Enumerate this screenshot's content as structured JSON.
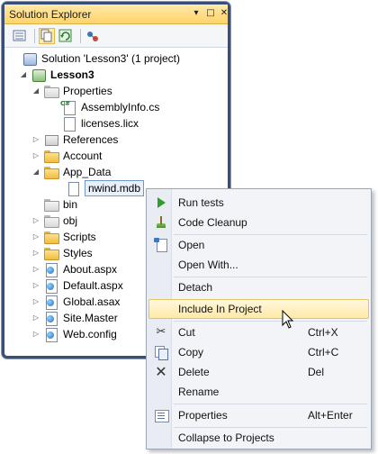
{
  "window": {
    "title": "Solution Explorer",
    "title_buttons": [
      "▾",
      "□",
      "✕"
    ]
  },
  "toolbar": {
    "icons": [
      "properties-icon",
      "show-all-files-icon",
      "refresh-icon",
      "view-class-diagram-icon"
    ]
  },
  "tree": {
    "items": [
      {
        "label": "Solution 'Lesson3' (1 project)",
        "icon": "solution-icon",
        "arrow": ""
      },
      {
        "label": "Lesson3",
        "icon": "web-project-icon",
        "arrow": "◢"
      },
      {
        "label": "Properties",
        "icon": "properties-folder-icon",
        "arrow": "◢"
      },
      {
        "label": "AssemblyInfo.cs",
        "icon": "csharp-file-icon",
        "arrow": ""
      },
      {
        "label": "licenses.licx",
        "icon": "file-icon",
        "arrow": ""
      },
      {
        "label": "References",
        "icon": "references-icon",
        "arrow": "▷"
      },
      {
        "label": "Account",
        "icon": "folder-icon",
        "arrow": "▷"
      },
      {
        "label": "App_Data",
        "icon": "folder-icon",
        "arrow": "◢"
      },
      {
        "label": "nwind.mdb",
        "icon": "database-file-icon",
        "arrow": ""
      },
      {
        "label": "bin",
        "icon": "hidden-folder-icon",
        "arrow": ""
      },
      {
        "label": "obj",
        "icon": "hidden-folder-icon",
        "arrow": "▷"
      },
      {
        "label": "Scripts",
        "icon": "folder-icon",
        "arrow": "▷"
      },
      {
        "label": "Styles",
        "icon": "folder-icon",
        "arrow": "▷"
      },
      {
        "label": "About.aspx",
        "icon": "aspx-file-icon",
        "arrow": "▷"
      },
      {
        "label": "Default.aspx",
        "icon": "aspx-file-icon",
        "arrow": "▷"
      },
      {
        "label": "Global.asax",
        "icon": "asax-file-icon",
        "arrow": "▷"
      },
      {
        "label": "Site.Master",
        "icon": "master-file-icon",
        "arrow": "▷"
      },
      {
        "label": "Web.config",
        "icon": "config-file-icon",
        "arrow": "▷"
      }
    ],
    "selected_item": "nwind.mdb"
  },
  "context_menu": {
    "items": [
      {
        "label": "Run tests",
        "shortcut": "",
        "icon": "run-tests-icon"
      },
      {
        "label": "Code Cleanup",
        "shortcut": "",
        "icon": "code-cleanup-icon"
      },
      {
        "label": "Open",
        "shortcut": "",
        "icon": "open-icon"
      },
      {
        "label": "Open With...",
        "shortcut": "",
        "icon": ""
      },
      {
        "label": "Detach",
        "shortcut": "",
        "icon": ""
      },
      {
        "label": "Include In Project",
        "shortcut": "",
        "icon": ""
      },
      {
        "label": "Cut",
        "shortcut": "Ctrl+X",
        "icon": "cut-icon"
      },
      {
        "label": "Copy",
        "shortcut": "Ctrl+C",
        "icon": "copy-icon"
      },
      {
        "label": "Delete",
        "shortcut": "Del",
        "icon": "delete-icon"
      },
      {
        "label": "Rename",
        "shortcut": "",
        "icon": ""
      },
      {
        "label": "Properties",
        "shortcut": "Alt+Enter",
        "icon": "properties-icon"
      },
      {
        "label": "Collapse to Projects",
        "shortcut": "",
        "icon": ""
      }
    ],
    "hovered_item": "Include In Project"
  },
  "colors": {
    "titlebar": "#ffd46b",
    "window_border": "#3a4f77",
    "menu_background": "#f2f4f8",
    "menu_hover": "#ffe9a6",
    "selection_border": "#6e98c9"
  }
}
